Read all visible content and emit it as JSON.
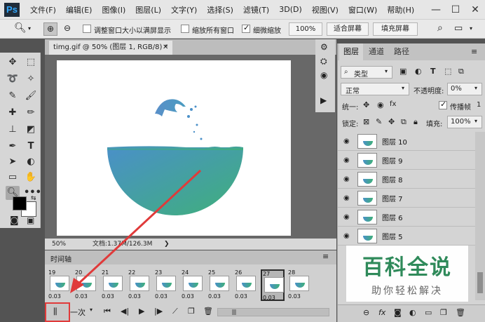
{
  "app": {
    "logo": "Ps"
  },
  "menu": [
    "文件(F)",
    "编辑(E)",
    "图像(I)",
    "图层(L)",
    "文字(Y)",
    "选择(S)",
    "滤镜(T)",
    "3D(D)",
    "视图(V)",
    "窗口(W)",
    "帮助(H)"
  ],
  "window_controls": {
    "minimize": "—",
    "maximize": "☐",
    "close": "✕"
  },
  "options_bar": {
    "resize_windows_label": "调整窗口大小以满屏显示",
    "zoom_all_label": "缩放所有窗口",
    "scrubby_zoom_label": "细微缩放",
    "zoom_value": "100%",
    "fit_screen": "适合屏幕",
    "fill_screen": "填充屏幕",
    "resize_windows_checked": false,
    "zoom_all_checked": false,
    "scrubby_zoom_checked": true
  },
  "document": {
    "tab_title": "timg.gif @ 50% (图层 1, RGB/8) *",
    "zoom": "50%",
    "doc_size": "文档:1.37M/126.3M"
  },
  "timeline": {
    "title": "时间轴",
    "loop": "一次",
    "frames": [
      {
        "num": "19",
        "delay": "0.03"
      },
      {
        "num": "20",
        "delay": "0.03"
      },
      {
        "num": "21",
        "delay": "0.03"
      },
      {
        "num": "22",
        "delay": "0.03"
      },
      {
        "num": "23",
        "delay": "0.03"
      },
      {
        "num": "24",
        "delay": "0.03"
      },
      {
        "num": "25",
        "delay": "0.03"
      },
      {
        "num": "26",
        "delay": "0.03"
      },
      {
        "num": "27",
        "delay": "0.03"
      },
      {
        "num": "28",
        "delay": "0.03"
      }
    ],
    "current_frame": "27"
  },
  "layers_panel": {
    "tabs": [
      "图层",
      "通道",
      "路径"
    ],
    "filter_kind": "类型",
    "blend_mode": "正常",
    "opacity_label": "不透明度:",
    "opacity_value": "0%",
    "unify_label": "统一:",
    "propagate_label": "传播帧",
    "propagate_value": "1",
    "lock_label": "锁定:",
    "fill_label": "填充:",
    "fill_value": "100%",
    "layers": [
      "图层 10",
      "图层 9",
      "图层 8",
      "图层 7",
      "图层 6",
      "图层 5"
    ]
  },
  "watermark": {
    "title": "百科全说",
    "subtitle": "助你轻松解决"
  },
  "colors": {
    "bowl_start": "#4a90c8",
    "bowl_end": "#3fb07a",
    "arrow": "#e03a3a",
    "ps_blue": "#31a8ff"
  }
}
